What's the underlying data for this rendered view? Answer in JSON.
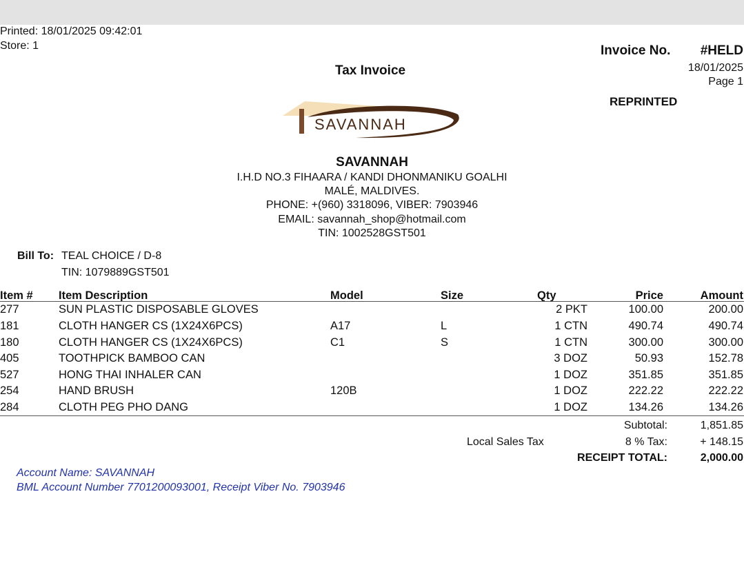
{
  "header": {
    "printed": "Printed: 18/01/2025 09:42:01",
    "store": "Store:  1",
    "title": "Tax Invoice",
    "invoice_label": "Invoice No.",
    "invoice_no": "#HELD",
    "date": "18/01/2025",
    "page": "Page   1",
    "reprinted": "REPRINTED"
  },
  "logo": {
    "text": "SAVANNAH",
    "colors": {
      "roof": "#f4dfb8",
      "post": "#7a4a2a",
      "swoosh": "#4a2a14"
    }
  },
  "company": {
    "name": "SAVANNAH",
    "address1": "I.H.D NO.3 FIHAARA / KANDI DHONMANIKU GOALHI",
    "address2": "MALÉ, MALDIVES.",
    "phone": "PHONE: +(960) 3318096, VIBER: 7903946",
    "email": "EMAIL: savannah_shop@hotmail.com",
    "tin": "TIN: 1002528GST501"
  },
  "bill_to": {
    "label": "Bill To:",
    "name": "TEAL CHOICE / D-8",
    "tin": "TIN: 1079889GST501"
  },
  "table": {
    "headers": {
      "item": "Item #",
      "desc": "Item Description",
      "model": "Model",
      "size": "Size",
      "qty": "Qty",
      "price": "Price",
      "amount": "Amount"
    },
    "rows": [
      {
        "item": "277",
        "desc": "SUN PLASTIC DISPOSABLE GLOVES",
        "model": "",
        "size": "",
        "qty": "2 PKT",
        "price": "100.00",
        "amount": "200.00"
      },
      {
        "item": "181",
        "desc": "CLOTH HANGER CS (1X24X6PCS)",
        "model": "A17",
        "size": "L",
        "qty": "1 CTN",
        "price": "490.74",
        "amount": "490.74"
      },
      {
        "item": "180",
        "desc": "CLOTH HANGER CS (1X24X6PCS)",
        "model": "C1",
        "size": "S",
        "qty": "1 CTN",
        "price": "300.00",
        "amount": "300.00"
      },
      {
        "item": "405",
        "desc": "TOOTHPICK BAMBOO CAN",
        "model": "",
        "size": "",
        "qty": "3 DOZ",
        "price": "50.93",
        "amount": "152.78"
      },
      {
        "item": "527",
        "desc": "HONG THAI INHALER CAN",
        "model": "",
        "size": "",
        "qty": "1 DOZ",
        "price": "351.85",
        "amount": "351.85"
      },
      {
        "item": "254",
        "desc": "HAND BRUSH",
        "model": "120B",
        "size": "",
        "qty": "1 DOZ",
        "price": "222.22",
        "amount": "222.22"
      },
      {
        "item": "284",
        "desc": "CLOTH PEG PHO DANG",
        "model": "",
        "size": "",
        "qty": "1 DOZ",
        "price": "134.26",
        "amount": "134.26"
      }
    ]
  },
  "totals": {
    "subtotal_label": "Subtotal:",
    "subtotal": "1,851.85",
    "tax_name": "Local Sales Tax",
    "tax_label": "8 % Tax:",
    "tax": "+  148.15",
    "total_label": "RECEIPT TOTAL:",
    "total": "2,000.00"
  },
  "footer": {
    "account_name": "Account Name: SAVANNAH",
    "account_number": "BML  Account Number 7701200093001, Receipt Viber No. 7903946"
  }
}
